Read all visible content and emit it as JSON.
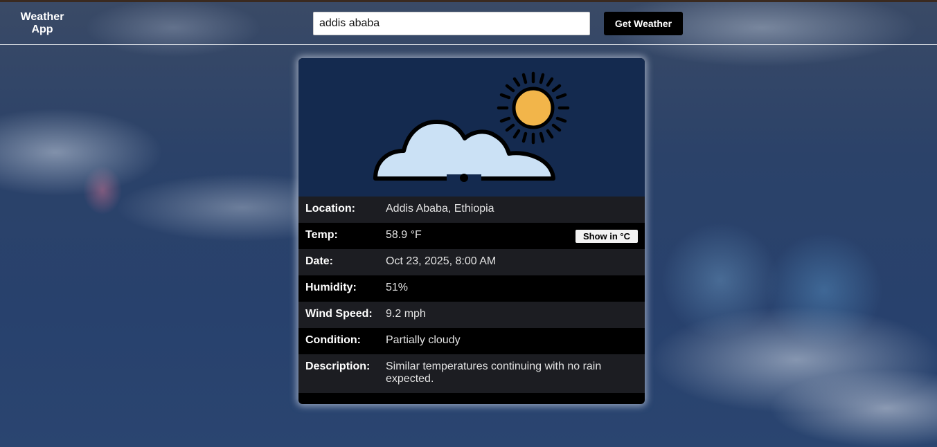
{
  "app": {
    "title": "Weather App"
  },
  "search": {
    "value": "addis ababa",
    "button_label": "Get Weather"
  },
  "weather": {
    "icon": "partly-cloudy-day-icon",
    "rows": [
      {
        "label": "Location:",
        "value": "Addis Ababa, Ethiopia"
      },
      {
        "label": "Temp:",
        "value": "58.9 °F",
        "toggle_label": "Show in °C"
      },
      {
        "label": "Date:",
        "value": "Oct 23, 2025, 8:00 AM"
      },
      {
        "label": "Humidity:",
        "value": "51%"
      },
      {
        "label": "Wind Speed:",
        "value": "9.2 mph"
      },
      {
        "label": "Condition:",
        "value": "Partially cloudy"
      },
      {
        "label": "Description:",
        "value": "Similar temperatures continuing with no rain expected."
      }
    ]
  },
  "colors": {
    "card_icon_bg": "#142a4f",
    "sun": "#f2b54a",
    "cloud": "#cbe1f5",
    "row_alt": "#1c1d22"
  }
}
